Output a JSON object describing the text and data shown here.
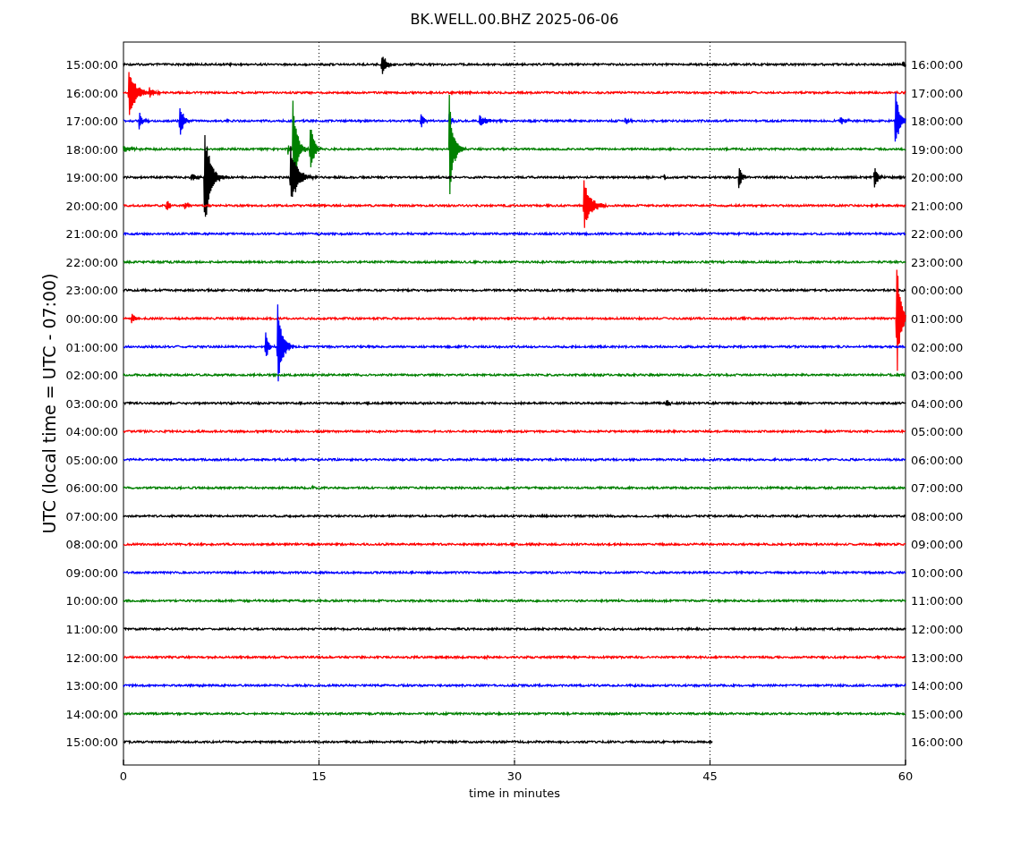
{
  "title": "BK.WELL.00.BHZ 2025-06-06",
  "ylabel": "UTC (local time = UTC - 07:00)",
  "xlabel": "time in minutes",
  "xticks": [
    "0",
    "15",
    "30",
    "45",
    "60"
  ],
  "traces": [
    {
      "left": "15:00:00",
      "right": "16:00:00",
      "color": "#000000"
    },
    {
      "left": "16:00:00",
      "right": "17:00:00",
      "color": "#ff0000"
    },
    {
      "left": "17:00:00",
      "right": "18:00:00",
      "color": "#0000ff"
    },
    {
      "left": "18:00:00",
      "right": "19:00:00",
      "color": "#008000"
    },
    {
      "left": "19:00:00",
      "right": "20:00:00",
      "color": "#000000"
    },
    {
      "left": "20:00:00",
      "right": "21:00:00",
      "color": "#ff0000"
    },
    {
      "left": "21:00:00",
      "right": "22:00:00",
      "color": "#0000ff"
    },
    {
      "left": "22:00:00",
      "right": "23:00:00",
      "color": "#008000"
    },
    {
      "left": "23:00:00",
      "right": "00:00:00",
      "color": "#000000"
    },
    {
      "left": "00:00:00",
      "right": "01:00:00",
      "color": "#ff0000"
    },
    {
      "left": "01:00:00",
      "right": "02:00:00",
      "color": "#0000ff"
    },
    {
      "left": "02:00:00",
      "right": "03:00:00",
      "color": "#008000"
    },
    {
      "left": "03:00:00",
      "right": "04:00:00",
      "color": "#000000"
    },
    {
      "left": "04:00:00",
      "right": "05:00:00",
      "color": "#ff0000"
    },
    {
      "left": "05:00:00",
      "right": "06:00:00",
      "color": "#0000ff"
    },
    {
      "left": "06:00:00",
      "right": "07:00:00",
      "color": "#008000"
    },
    {
      "left": "07:00:00",
      "right": "08:00:00",
      "color": "#000000"
    },
    {
      "left": "08:00:00",
      "right": "09:00:00",
      "color": "#ff0000"
    },
    {
      "left": "09:00:00",
      "right": "10:00:00",
      "color": "#0000ff"
    },
    {
      "left": "10:00:00",
      "right": "11:00:00",
      "color": "#008000"
    },
    {
      "left": "11:00:00",
      "right": "12:00:00",
      "color": "#000000"
    },
    {
      "left": "12:00:00",
      "right": "13:00:00",
      "color": "#ff0000"
    },
    {
      "left": "13:00:00",
      "right": "14:00:00",
      "color": "#0000ff"
    },
    {
      "left": "14:00:00",
      "right": "15:00:00",
      "color": "#008000"
    },
    {
      "left": "15:00:00",
      "right": "16:00:00",
      "color": "#000000"
    }
  ]
}
